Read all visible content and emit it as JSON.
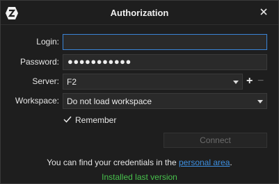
{
  "window": {
    "title": "Authorization",
    "logo_icon": "app-logo-icon",
    "close_icon": "close-icon"
  },
  "form": {
    "login_label": "Login:",
    "login_value": "",
    "password_label": "Password:",
    "password_masked": "●●●●●●●●●●●",
    "server_label": "Server:",
    "server_value": "F2",
    "workspace_label": "Workspace:",
    "workspace_value": "Do not load workspace",
    "remember_label": "Remember",
    "remember_checked": true,
    "connect_label": "Connect"
  },
  "footer": {
    "info_text": "You can find your credentials in the",
    "info_link": "personal area",
    "info_suffix": ".",
    "status_text": "Installed last version"
  },
  "colors": {
    "background": "#1e1e1e",
    "focus_border": "#3a84d6",
    "link": "#3d8fe0",
    "status_green": "#48c14d"
  }
}
